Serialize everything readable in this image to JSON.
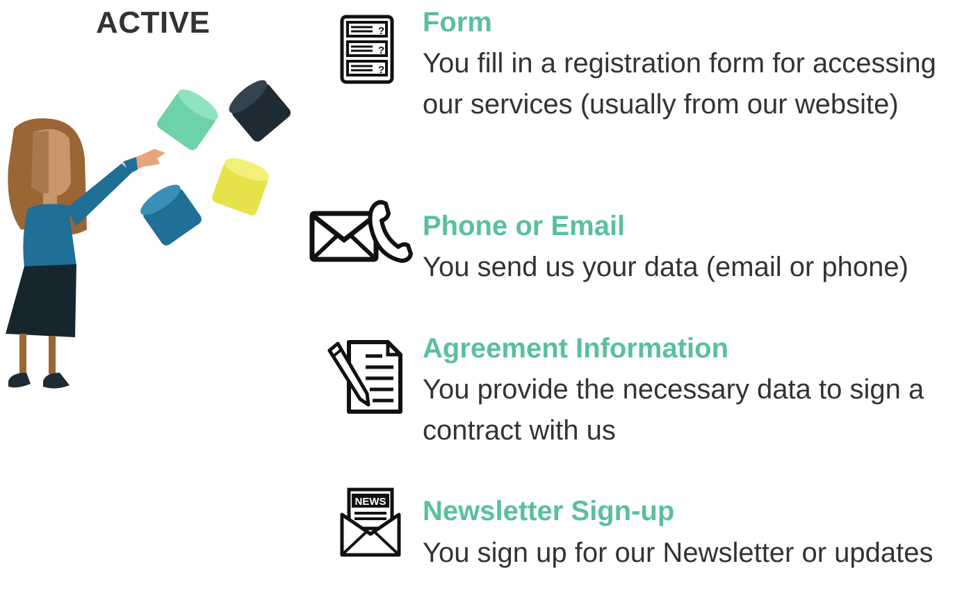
{
  "heading": "ACTIVE",
  "accent_color": "#59bfa0",
  "text_color": "#333333",
  "items": [
    {
      "icon": "form-icon",
      "title": "Form",
      "description": "You fill in a registration form for accessing our services (usually from our website)"
    },
    {
      "icon": "envelope-phone-icon",
      "title": "Phone or Email",
      "description": "You send us your data (email or phone)"
    },
    {
      "icon": "contract-signing-icon",
      "title": "Agreement Information",
      "description": "You provide the necessary data to sign a contract with us"
    },
    {
      "icon": "newsletter-icon",
      "title": "Newsletter Sign-up",
      "description": "You sign up for our Newsletter or updates"
    }
  ],
  "illustration": {
    "name": "woman-throwing-data-cylinders",
    "cylinder_colors": [
      "#6dd3a7",
      "#1f2b33",
      "#1f6f96",
      "#e6e34a"
    ]
  }
}
